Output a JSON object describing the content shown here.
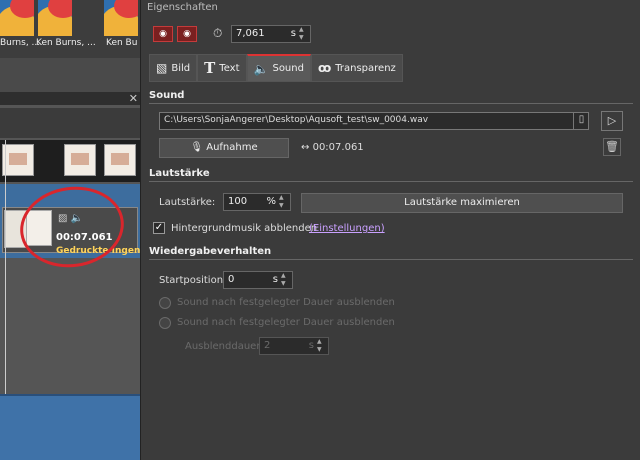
{
  "left": {
    "thumb_labels": [
      "Burns, ...",
      "Ken Burns, ...",
      "Ken Bu"
    ],
    "clip_time": "00:07.061",
    "clip_subtitle": "Gedruckte Ingen"
  },
  "panel": {
    "title": "Eigenschaften",
    "duration_value": "7,061",
    "duration_unit": "s",
    "tabs": [
      {
        "icon": "image-icon",
        "label": "Bild"
      },
      {
        "icon": "text-icon",
        "label": "Text"
      },
      {
        "icon": "speaker-icon",
        "label": "Sound"
      },
      {
        "icon": "transparency-icon",
        "label": "Transparenz"
      }
    ],
    "active_tab": "Sound"
  },
  "sound": {
    "heading": "Sound",
    "file_path": "C:\\Users\\SonjaAngerer\\Desktop\\Aqusoft_test\\sw_0004.wav",
    "record_label": "Aufnahme",
    "length": "00:07.061"
  },
  "volume": {
    "heading": "Lautstärke",
    "label": "Lautstärke:",
    "value": "100",
    "unit": "%",
    "maximize_label": "Lautstärke maximieren",
    "dim_music_label": "Hintergrundmusik abblenden",
    "dim_music_checked": true,
    "settings_link": "(Einstellungen)"
  },
  "playback": {
    "heading": "Wiedergabeverhalten",
    "start_label": "Startposition:",
    "start_value": "0",
    "start_unit": "s",
    "option1": "Sound nach festgelegter Dauer ausblenden",
    "option2": "Sound nach festgelegter Dauer ausblenden",
    "fade_label": "Ausblenddauer:",
    "fade_value": "2",
    "fade_unit": "s"
  },
  "colors": {
    "accent_red": "#d33",
    "annotation_circle": "#d9262c",
    "panel_bg": "#3b3b3b"
  }
}
